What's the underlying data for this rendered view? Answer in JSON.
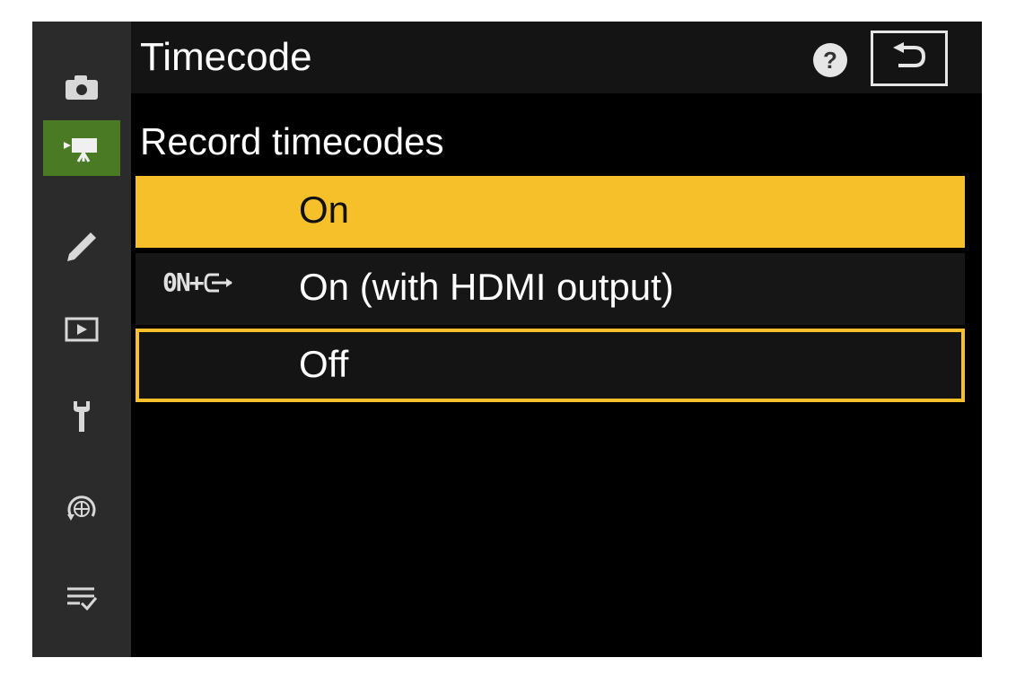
{
  "header": {
    "title": "Timecode",
    "help_icon": "question-mark",
    "help_glyph": "?",
    "back_icon": "return-arrow"
  },
  "subtitle": "Record timecodes",
  "options": [
    {
      "label": "On",
      "state": "highlighted",
      "icon": ""
    },
    {
      "label": "On (with HDMI output)",
      "state": "normal",
      "icon": "on-plus-hdmi",
      "icon_text": "0N+"
    },
    {
      "label": "Off",
      "state": "selected-outline",
      "icon": ""
    }
  ],
  "sidebar": {
    "tabs": [
      {
        "icon": "camera-icon",
        "active": false
      },
      {
        "icon": "movie-camera-icon",
        "active": true
      },
      {
        "icon": "pencil-icon",
        "active": false
      },
      {
        "icon": "playback-icon",
        "active": false
      },
      {
        "icon": "wrench-icon",
        "active": false
      },
      {
        "icon": "network-icon",
        "active": false
      },
      {
        "icon": "my-menu-icon",
        "active": false
      }
    ]
  },
  "colors": {
    "highlight": "#f5c02a",
    "active_tab": "#4a7a24",
    "background": "#000000",
    "sidebar": "#2b2b2b"
  }
}
